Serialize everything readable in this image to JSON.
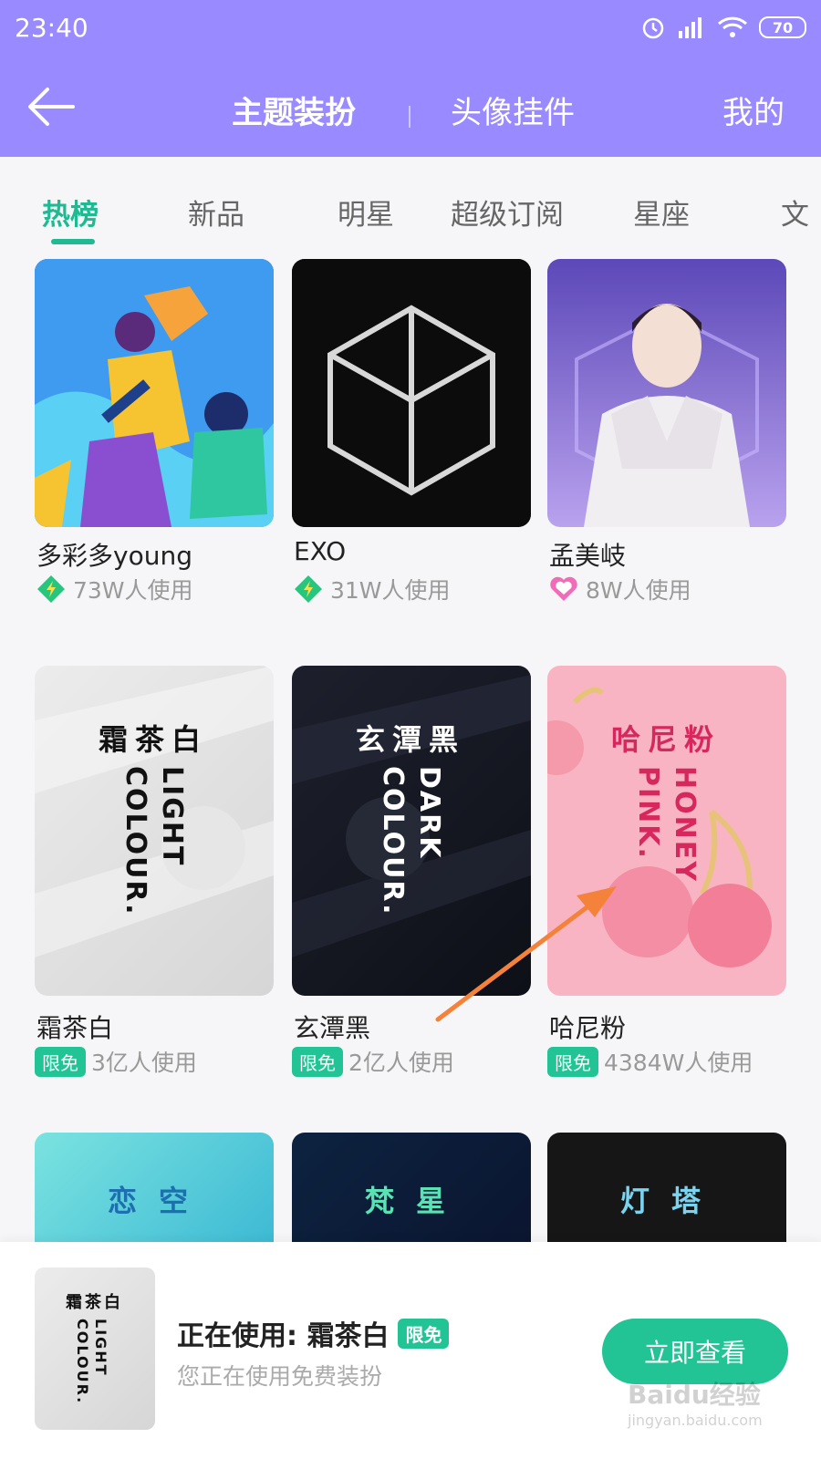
{
  "status_bar": {
    "time": "23:40",
    "battery": "70"
  },
  "nav": {
    "theme": "主题装扮",
    "avatar_pendant": "头像挂件",
    "mine": "我的"
  },
  "tabs": [
    "热榜",
    "新品",
    "明星",
    "超级订阅",
    "星座",
    "文"
  ],
  "cards": [
    {
      "title": "多彩多young",
      "users": "73W人使用"
    },
    {
      "title": "EXO",
      "users": "31W人使用"
    },
    {
      "title": "孟美岐",
      "users": "8W人使用"
    },
    {
      "title": "霜茶白",
      "badge": "限免",
      "users": "3亿人使用",
      "thumb_cn": "霜茶白",
      "thumb_en": "LIGHT COLOUR."
    },
    {
      "title": "玄潭黑",
      "badge": "限免",
      "users": "2亿人使用",
      "thumb_cn": "玄潭黑",
      "thumb_en": "DARK COLOUR."
    },
    {
      "title": "哈尼粉",
      "badge": "限免",
      "users": "4384W人使用",
      "thumb_cn": "哈尼粉",
      "thumb_en": "HONEY PINK."
    },
    {
      "thumb_cn": "恋空"
    },
    {
      "thumb_cn": "梵星"
    },
    {
      "thumb_cn": "灯塔"
    }
  ],
  "bottom": {
    "using": "正在使用: 霜茶白",
    "badge": "限免",
    "subtitle": "您正在使用免费装扮",
    "button": "立即查看",
    "thumb_cn": "霜茶白",
    "thumb_en": "LIGHT COLOUR."
  },
  "watermark": {
    "brand": "Baidu经验",
    "url": "jingyan.baidu.com"
  },
  "colors": {
    "header": "#998bff",
    "accent": "#22c394",
    "arrow": "#f4823a"
  }
}
